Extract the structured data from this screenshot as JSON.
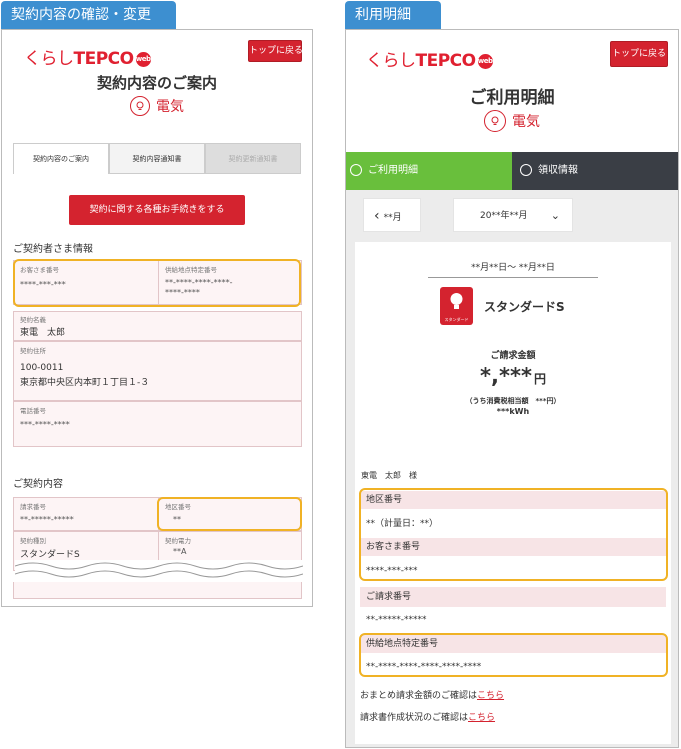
{
  "left": {
    "tag": "契約内容の確認・変更",
    "logo_kurashi": "くらし",
    "logo_tepco": "TEPCO",
    "logo_web": "web",
    "top_button": "トップに戻る",
    "title": "契約内容のご案内",
    "energy": "電気",
    "tabs": [
      "契約内容のご案内",
      "契約内容通知書",
      "契約更新通知書"
    ],
    "procedure_button": "契約に関する各種お手続きをする",
    "contractor_section": "ご契約者さま情報",
    "customer_no_label": "お客さま番号",
    "customer_no_value": "****-***-***",
    "supply_point_label": "供給地点特定番号",
    "supply_point_value_1": "**-****-****-****-",
    "supply_point_value_2": "****-****",
    "name_label": "契約名義",
    "name_value": "東電　太郎",
    "address_label": "契約住所",
    "address_zip": "100-0011",
    "address_value": "東京都中央区内本町１丁目１-３",
    "phone_label": "電話番号",
    "phone_value": "***-****-****",
    "contract_section": "ご契約内容",
    "billing_no_label": "請求番号",
    "billing_no_value": "**-*****-*****",
    "area_no_label": "地区番号",
    "area_no_value": "**",
    "plan_label": "契約種別",
    "plan_value": "スタンダードS",
    "power_label": "契約電力",
    "power_value": "**A"
  },
  "right": {
    "tag": "利用明細",
    "logo_kurashi": "くらし",
    "logo_tepco": "TEPCO",
    "logo_web": "web",
    "top_button": "トップに戻る",
    "title": "ご利用明細",
    "energy": "電気",
    "tab_usage": "ご利用明細",
    "tab_receipt": "領収情報",
    "prev_month": "**月",
    "month_select": "20**年**月",
    "period": "**月**日～ **月**日",
    "plan_name": "スタンダードS",
    "plan_icon_label": "スタンダード",
    "billing_amount_label": "ご請求金額",
    "billing_amount_value": "*,***",
    "yen": "円",
    "tax_note": "（うち消費税相当額　***円）",
    "usage_kwh": "***kWh",
    "customer_name": "東電　太郎　様",
    "area_no_label": "地区番号",
    "area_no_value": "**（計量日：**）",
    "customer_no_label": "お客さま番号",
    "customer_no_value": "****-***-***",
    "billing_no_label": "ご請求番号",
    "billing_no_value": "**-*****-*****",
    "supply_point_label": "供給地点特定番号",
    "supply_point_value": "**-****-****-****-****-****",
    "summary_text": "おまとめ請求金額のご確認は",
    "summary_link": "こちら",
    "invoice_text": "請求書作成状況のご確認は",
    "invoice_link": "こちら"
  },
  "colors": {
    "accent_red": "#d4232f",
    "highlight_yellow": "#f0b225",
    "tag_blue": "#3d8fd0",
    "tab_green": "#69bf3c",
    "tab_dark": "#3a3e45"
  }
}
